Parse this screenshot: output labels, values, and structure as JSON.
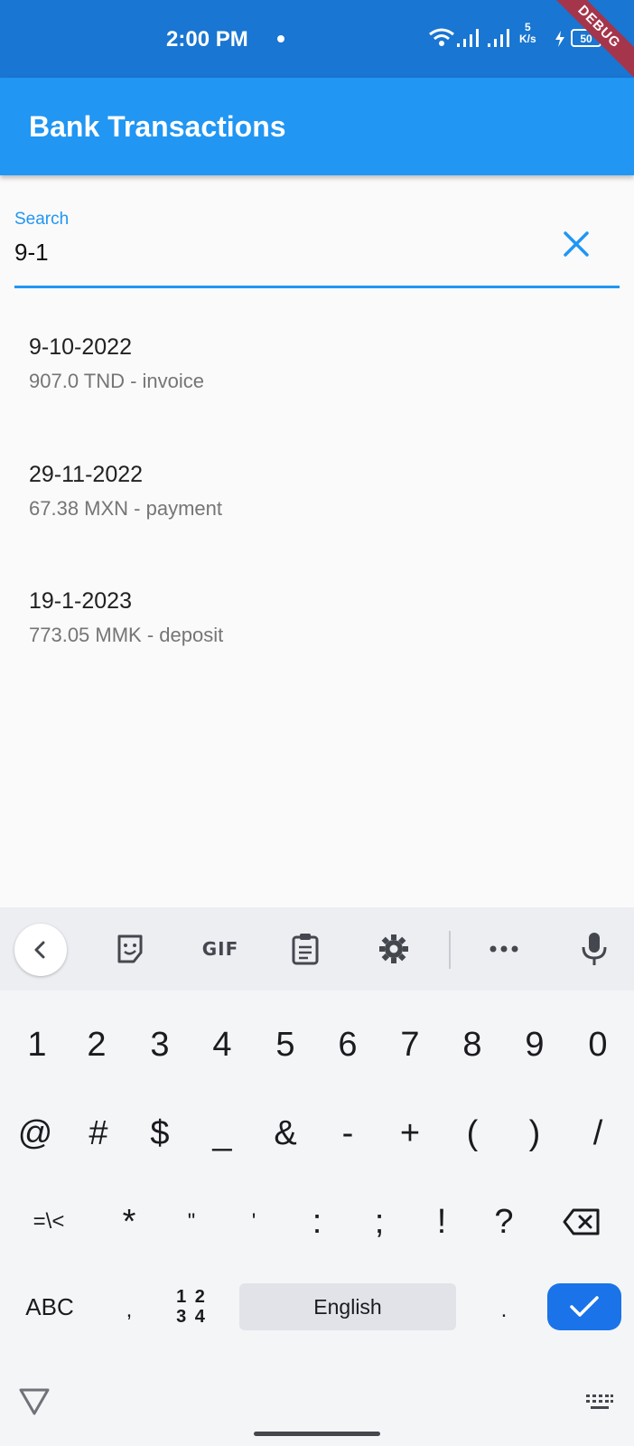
{
  "status_bar": {
    "time": "2:00 PM",
    "net_speed_value": "5",
    "net_speed_unit": "K/s",
    "battery_level": "50",
    "debug_banner": "DEBUG"
  },
  "app_bar": {
    "title": "Bank Transactions"
  },
  "search": {
    "label": "Search",
    "value": "9-1"
  },
  "transactions": [
    {
      "date": "9-10-2022",
      "detail": "907.0 TND - invoice"
    },
    {
      "date": "29-11-2022",
      "detail": "67.38 MXN - payment"
    },
    {
      "date": "19-1-2023",
      "detail": "773.05 MMK - deposit"
    }
  ],
  "keyboard": {
    "toolbar": {
      "gif_label": "GIF"
    },
    "row1": [
      "1",
      "2",
      "3",
      "4",
      "5",
      "6",
      "7",
      "8",
      "9",
      "0"
    ],
    "row2": [
      "@",
      "#",
      "$",
      "_",
      "&",
      "-",
      "+",
      "(",
      ")",
      "/"
    ],
    "row3": [
      "=\\<",
      "*",
      "\"",
      "'",
      ":",
      ";",
      "!",
      "?"
    ],
    "abc_label": "ABC",
    "comma": ",",
    "num_label_top": "1 2",
    "num_label_bottom": "3 4",
    "space_label": "English",
    "period": "."
  },
  "colors": {
    "primary": "#2196f3",
    "status_bar": "#1976d2",
    "enter_key": "#1a73e8"
  }
}
